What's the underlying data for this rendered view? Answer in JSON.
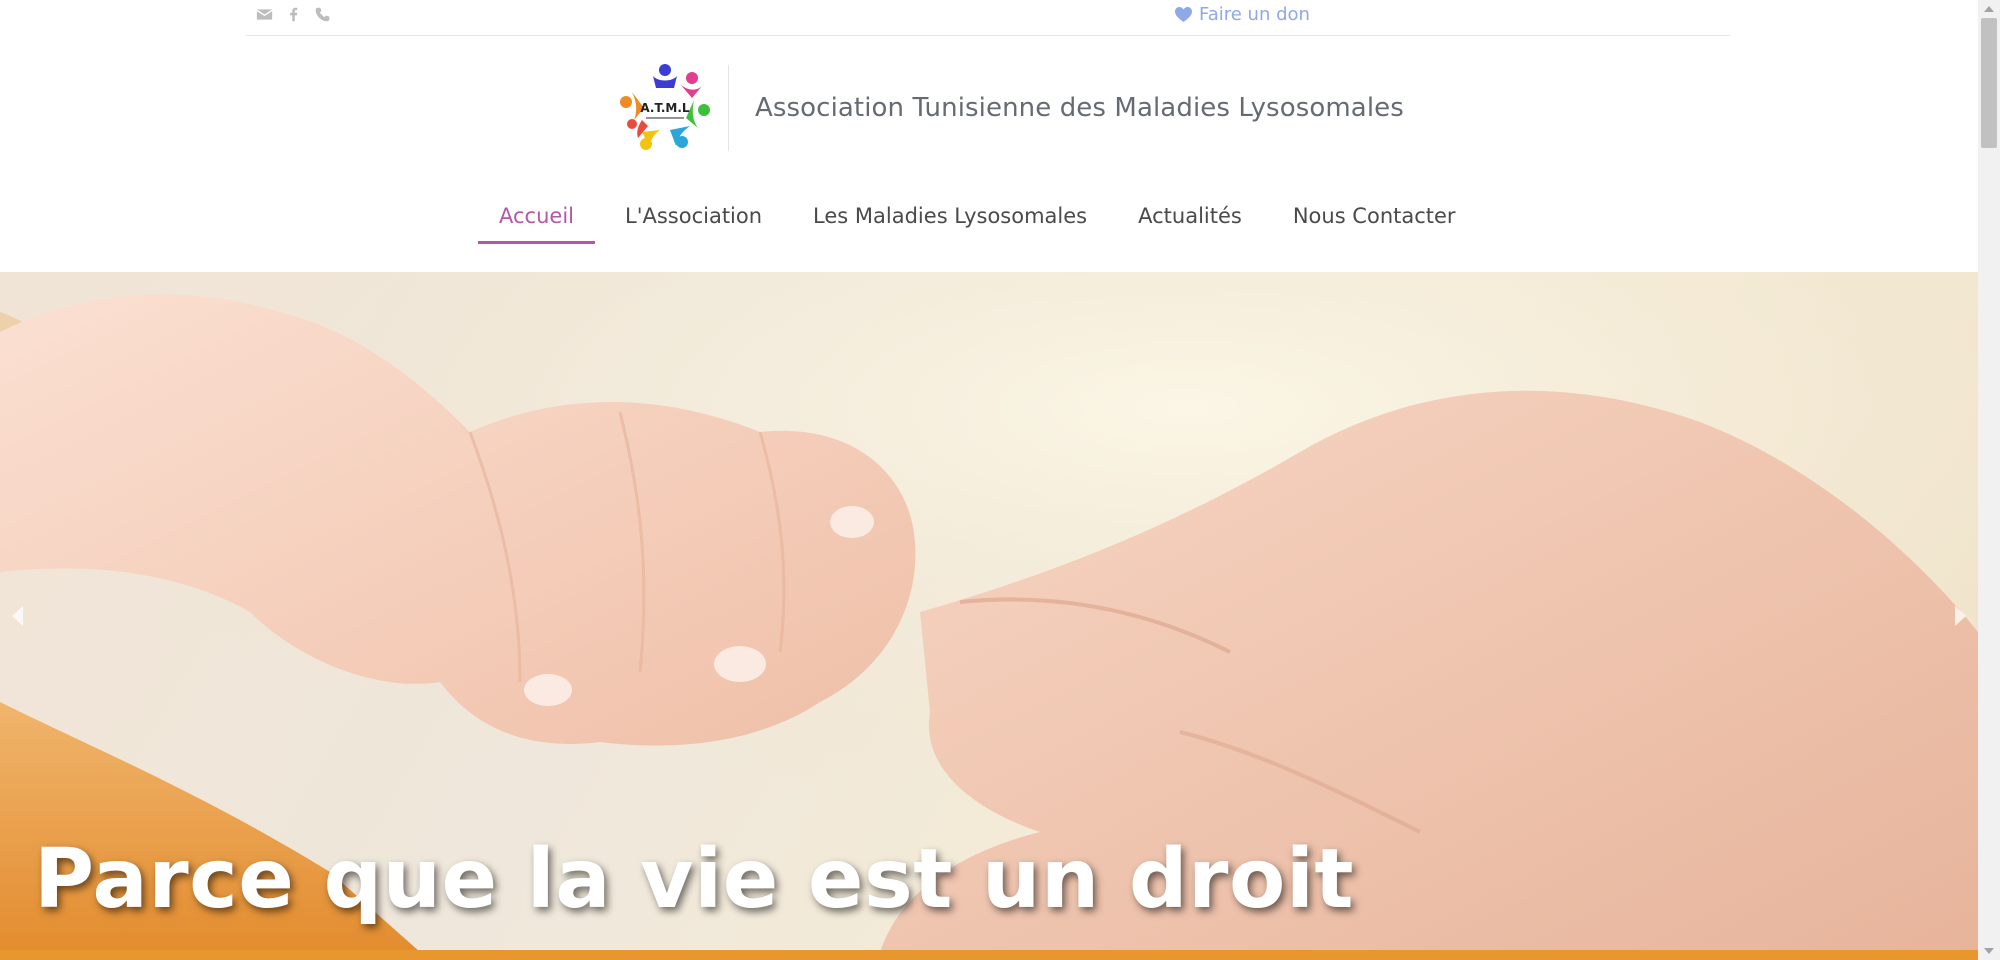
{
  "topbar": {
    "icons": [
      "envelope-icon",
      "facebook-icon",
      "phone-icon"
    ],
    "donate_label": "Faire un don",
    "donate_icon": "heart-icon"
  },
  "header": {
    "logo_text": "A.T.M.L",
    "site_title": "Association Tunisienne des Maladies Lysosomales"
  },
  "nav": {
    "items": [
      {
        "label": "Accueil",
        "active": true
      },
      {
        "label": "L'Association",
        "active": false
      },
      {
        "label": "Les Maladies Lysosomales",
        "active": false
      },
      {
        "label": "Actualités",
        "active": false
      },
      {
        "label": "Nous Contacter",
        "active": false
      }
    ]
  },
  "hero": {
    "caption": "Parce que la vie est un droit",
    "prev_icon": "chevron-left-icon",
    "next_icon": "chevron-right-icon"
  },
  "colors": {
    "accent": "#b457a6",
    "donate": "#8fa8e8",
    "title": "#666b73",
    "band": "#e8972f"
  }
}
